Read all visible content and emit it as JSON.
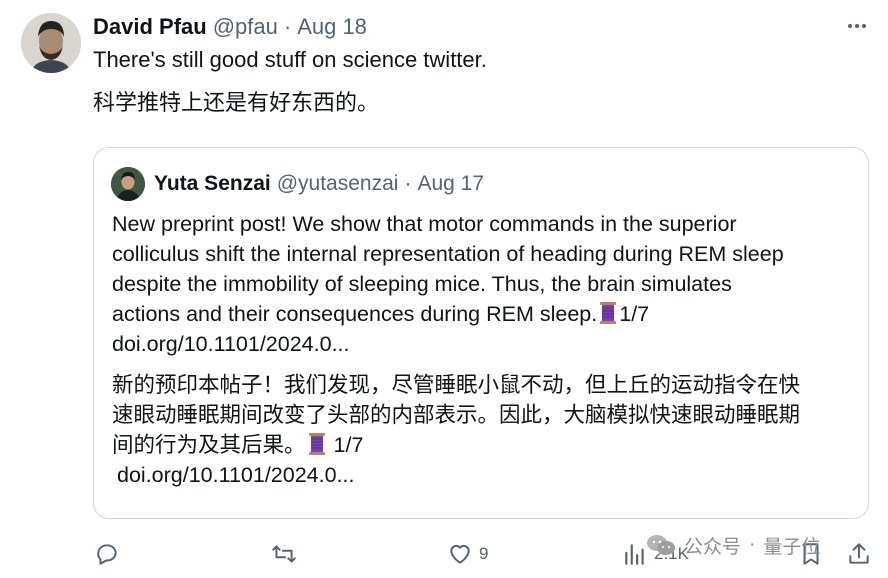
{
  "tweet": {
    "author_name": "David Pfau",
    "handle": "@pfau",
    "separator": "·",
    "date": "Aug 18",
    "text_en": "There's still good stuff on science twitter.",
    "text_zh": "科学推特上还是有好东西的。"
  },
  "quote": {
    "author_name": "Yuta Senzai",
    "handle": "@yutasenzai",
    "separator": "·",
    "date": "Aug 17",
    "en_lines": [
      "New preprint post! We show that motor commands in the superior",
      "colliculus shift the internal representation of heading during REM sleep",
      "despite the immobility of sleeping mice. Thus, the brain simulates",
      "actions and their consequences during REM sleep."
    ],
    "en_thread": "1/7",
    "en_link": "doi.org/10.1101/2024.0...",
    "zh_lines": [
      "新的预印本帖子！我们发现，尽管睡眠小鼠不动，但上丘的运动指令在快",
      "速眼动睡眠期间改变了头部的内部表示。因此，大脑模拟快速眼动睡眠期",
      "间的行为及其后果。"
    ],
    "zh_thread": "1/7",
    "zh_link": "doi.org/10.1101/2024.0...",
    "thread_icon": "spool-of-thread-icon"
  },
  "actions": {
    "likes": "9",
    "views": "2.1K"
  },
  "watermark": {
    "left": "公众号",
    "separator": "·",
    "right": "量子位"
  },
  "colors": {
    "text": "#0f1419",
    "muted": "#536471",
    "border": "#cfd9de",
    "spool": "#7b3fb0"
  }
}
